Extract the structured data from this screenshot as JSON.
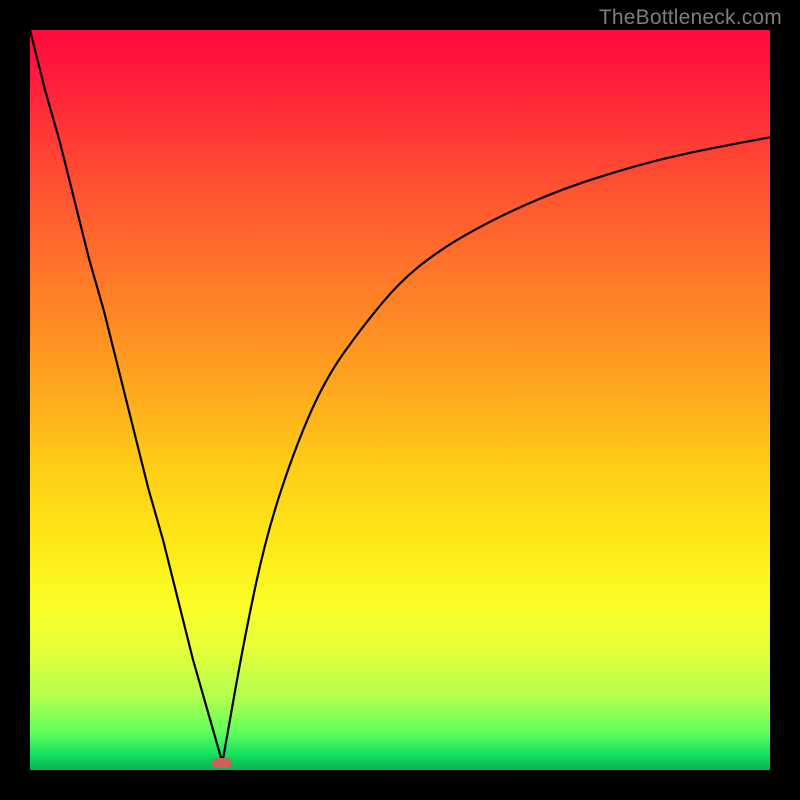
{
  "watermark": "TheBottleneck.com",
  "colors": {
    "frame": "#000000",
    "curve": "#000000",
    "marker": "#c8645a",
    "gradient_stops": [
      "#ff0a3c",
      "#ff1f3a",
      "#ff4d32",
      "#ff7a28",
      "#ffa61f",
      "#ffd016",
      "#fdea16",
      "#fbff28",
      "#e4ff3a",
      "#b4ff4e",
      "#5eff5e",
      "#10e060",
      "#08b050"
    ]
  },
  "chart_data": {
    "type": "line",
    "title": "",
    "xlabel": "",
    "ylabel": "",
    "xlim": [
      0,
      100
    ],
    "ylim": [
      0,
      100
    ],
    "annotations": [
      "TheBottleneck.com"
    ],
    "marker": {
      "x": 26,
      "y": 1
    },
    "series": [
      {
        "name": "left-branch",
        "x": [
          0,
          2,
          4,
          6,
          8,
          10,
          12,
          14,
          16,
          18,
          20,
          22,
          24,
          26
        ],
        "values": [
          100,
          92,
          85,
          77,
          69,
          62,
          54,
          46,
          38,
          31,
          23,
          15,
          8,
          1
        ]
      },
      {
        "name": "right-branch",
        "x": [
          26,
          29,
          32,
          36,
          40,
          45,
          50,
          55,
          60,
          66,
          72,
          78,
          85,
          92,
          100
        ],
        "values": [
          1,
          18,
          32,
          44,
          53,
          60,
          66,
          70,
          73,
          76,
          78.5,
          80.5,
          82.5,
          84,
          85.5
        ]
      }
    ]
  }
}
